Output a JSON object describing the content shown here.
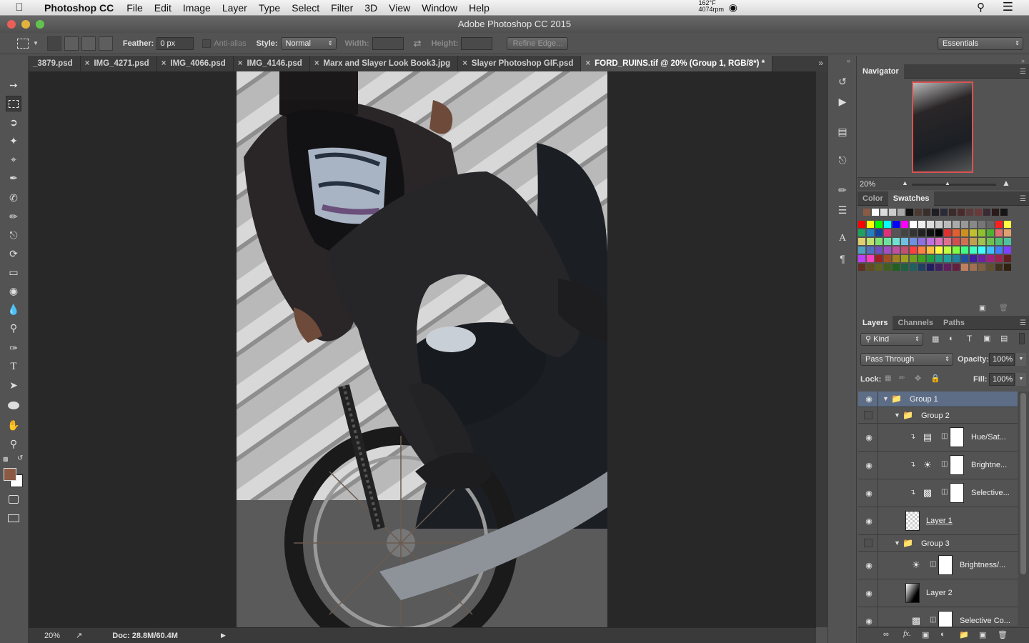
{
  "menubar": {
    "apple_icon": "apple-icon",
    "app_name": "Photoshop CC",
    "menus": [
      "File",
      "Edit",
      "Image",
      "Layer",
      "Type",
      "Select",
      "Filter",
      "3D",
      "View",
      "Window",
      "Help"
    ],
    "temp": "162°F",
    "rpm": "4074rpm"
  },
  "window": {
    "title": "Adobe Photoshop CC 2015"
  },
  "options": {
    "feather_label": "Feather:",
    "feather_value": "0 px",
    "antialias_label": "Anti-alias",
    "style_label": "Style:",
    "style_value": "Normal",
    "width_label": "Width:",
    "height_label": "Height:",
    "refine_label": "Refine Edge...",
    "workspace": "Essentials"
  },
  "tabs": [
    {
      "label": "_3879.psd"
    },
    {
      "label": "IMG_4271.psd"
    },
    {
      "label": "IMG_4066.psd"
    },
    {
      "label": "IMG_4146.psd"
    },
    {
      "label": "Marx and Slayer Look Book3.jpg"
    },
    {
      "label": "Slayer Photoshop GIF.psd"
    },
    {
      "label": "FORD_RUINS.tif @ 20% (Group 1, RGB/8*) *"
    }
  ],
  "status": {
    "zoom": "20%",
    "doc": "Doc: 28.8M/60.4M"
  },
  "navigator": {
    "title": "Navigator",
    "zoom": "20%"
  },
  "color_panel": {
    "tab_color": "Color",
    "tab_swatches": "Swatches"
  },
  "layers_panel": {
    "tab_layers": "Layers",
    "tab_channels": "Channels",
    "tab_paths": "Paths",
    "kind_label": "Kind",
    "blend_mode": "Pass Through",
    "opacity_label": "Opacity:",
    "opacity_value": "100%",
    "lock_label": "Lock:",
    "fill_label": "Fill:",
    "fill_value": "100%",
    "layers": [
      {
        "name": "Group 1"
      },
      {
        "name": "Group 2"
      },
      {
        "name": "Hue/Sat..."
      },
      {
        "name": "Brightne..."
      },
      {
        "name": "Selective..."
      },
      {
        "name": "Layer 1"
      },
      {
        "name": "Group 3"
      },
      {
        "name": "Brightness/..."
      },
      {
        "name": "Layer 2"
      },
      {
        "name": "Selective Co..."
      }
    ]
  },
  "colors": {
    "foreground": "#8b5a45",
    "background": "#ffffff",
    "selected_layer": "#5d6d85"
  }
}
